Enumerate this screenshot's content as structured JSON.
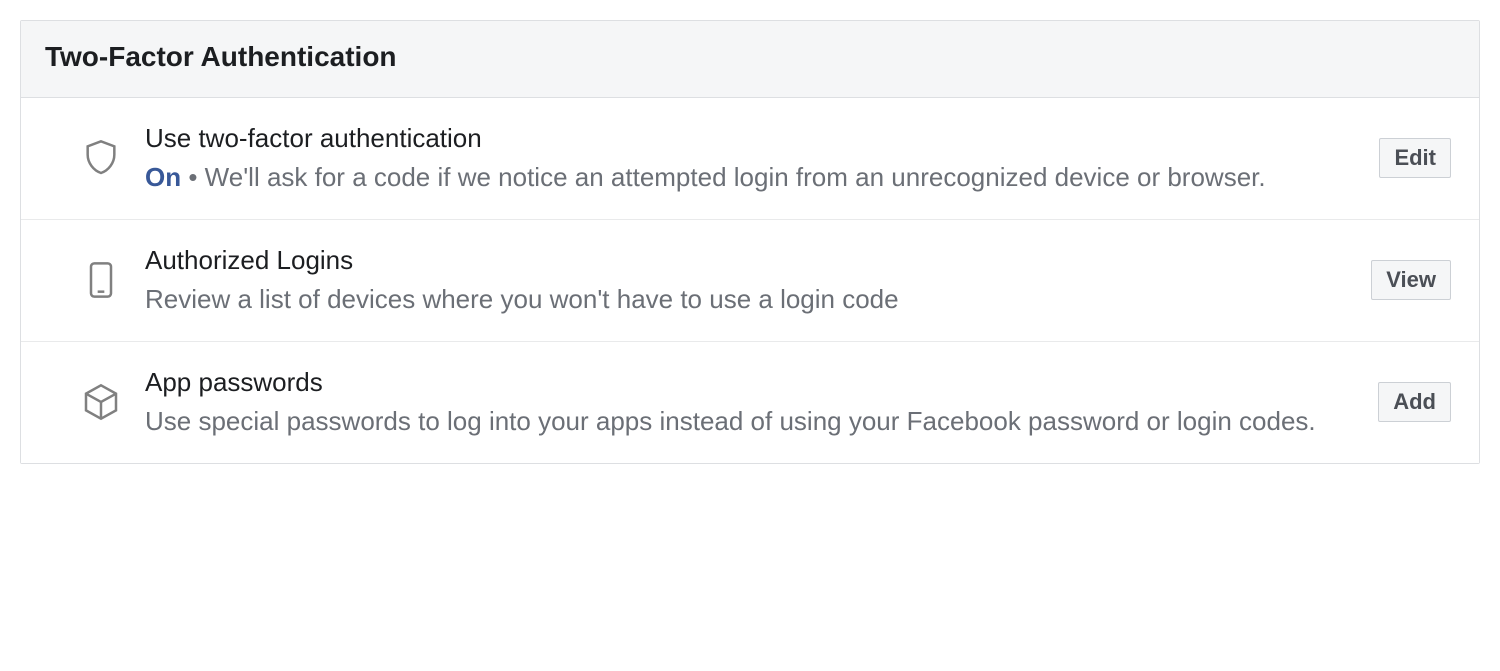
{
  "panel": {
    "title": "Two-Factor Authentication"
  },
  "rows": {
    "useTwoFactor": {
      "title": "Use two-factor authentication",
      "status": "On",
      "separator": " • ",
      "description": "We'll ask for a code if we notice an attempted login from an unrecognized device or browser.",
      "action": "Edit"
    },
    "authorizedLogins": {
      "title": "Authorized Logins",
      "description": "Review a list of devices where you won't have to use a login code",
      "action": "View"
    },
    "appPasswords": {
      "title": "App passwords",
      "description": "Use special passwords to log into your apps instead of using your Facebook password or login codes.",
      "action": "Add"
    }
  }
}
